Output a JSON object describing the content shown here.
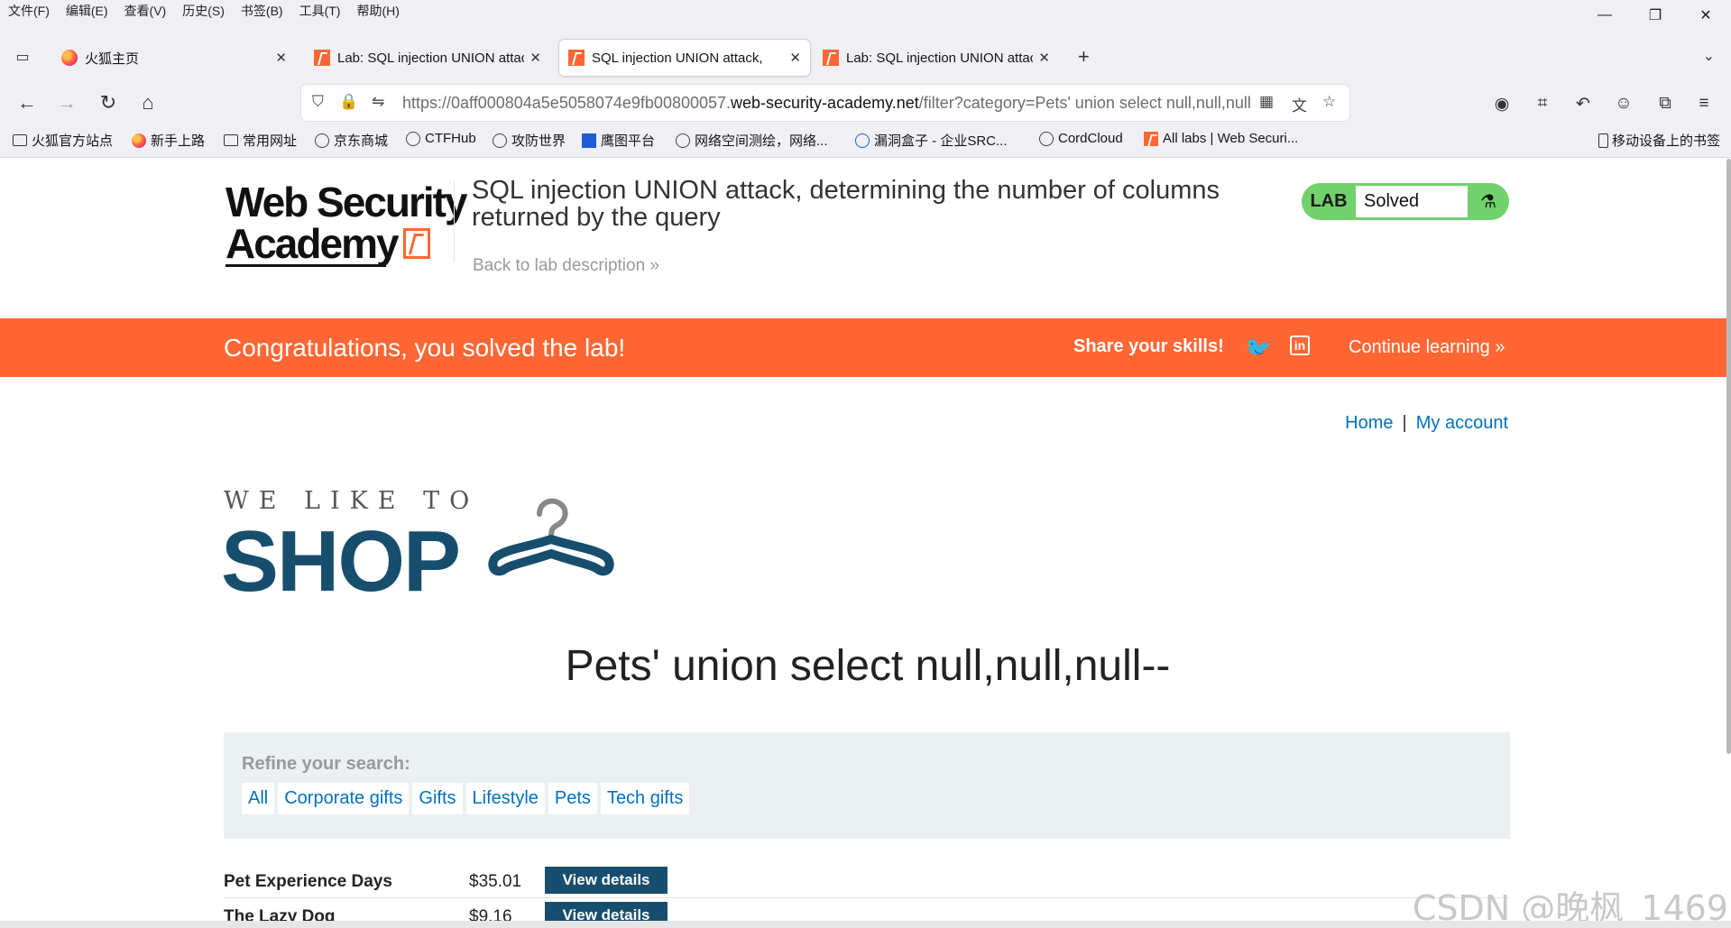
{
  "menu": [
    "文件(F)",
    "编辑(E)",
    "查看(V)",
    "历史(S)",
    "书签(B)",
    "工具(T)",
    "帮助(H)"
  ],
  "window_controls": {
    "minimize": "—",
    "restore": "❐",
    "close": "✕"
  },
  "tabs": [
    {
      "label": "火狐主页",
      "active": false,
      "icon": "firefox-icon"
    },
    {
      "label": "Lab: SQL injection UNION attack",
      "active": false,
      "icon": "portswigger-icon"
    },
    {
      "label": "SQL injection UNION attack,",
      "active": true,
      "icon": "portswigger-icon"
    },
    {
      "label": "Lab: SQL injection UNION attack",
      "active": false,
      "icon": "portswigger-icon"
    }
  ],
  "url": {
    "prefix": "https://0aff000804a5e5058074e9fb00800057.",
    "domain": "web-security-academy.net",
    "path": "/filter?category=Pets' union select null,null,null--"
  },
  "bookmarks": [
    {
      "label": "火狐官方站点",
      "icon": "folder-icon"
    },
    {
      "label": "新手上路",
      "icon": "firefox-icon"
    },
    {
      "label": "常用网址",
      "icon": "folder-icon"
    },
    {
      "label": "京东商城",
      "icon": "globe-icon"
    },
    {
      "label": "CTFHub",
      "icon": "ctfhub-icon"
    },
    {
      "label": "攻防世界",
      "icon": "globe-icon"
    },
    {
      "label": "鹰图平台",
      "icon": "hunter-icon"
    },
    {
      "label": "网络空间测绘，网络...",
      "icon": "fofa-icon"
    },
    {
      "label": "漏洞盒子 - 企业SRC...",
      "icon": "vulbox-icon"
    },
    {
      "label": "CordCloud",
      "icon": "cordcloud-icon"
    },
    {
      "label": "All labs | Web Securi...",
      "icon": "portswigger-icon"
    }
  ],
  "bookmarks_right": "移动设备上的书签",
  "academy": {
    "logo_line1": "Web Security",
    "logo_line2": "Academy",
    "lab_title": "SQL injection UNION attack, determining the number of columns returned by the query",
    "back_link": "Back to lab description",
    "badge_label": "LAB",
    "badge_status": "Solved",
    "badge_color": "#70d16d"
  },
  "banner": {
    "congrats": "Congratulations, you solved the lab!",
    "share": "Share your skills!",
    "continue": "Continue learning",
    "color": "#ff6633"
  },
  "nav": {
    "home": "Home",
    "separator": "|",
    "account": "My account"
  },
  "shop": {
    "tagline": "WE LIKE TO",
    "title": "SHOP"
  },
  "search_heading": "Pets' union select null,null,null--",
  "filter": {
    "label": "Refine your search:",
    "categories": [
      "All",
      "Corporate gifts",
      "Gifts",
      "Lifestyle",
      "Pets",
      "Tech gifts"
    ]
  },
  "products": [
    {
      "name": "Pet Experience Days",
      "price": "$35.01",
      "button": "View details"
    },
    {
      "name": "The Lazy Dog",
      "price": "$9.16",
      "button": "View details"
    }
  ],
  "watermark": "CSDN @晚枫_1469"
}
